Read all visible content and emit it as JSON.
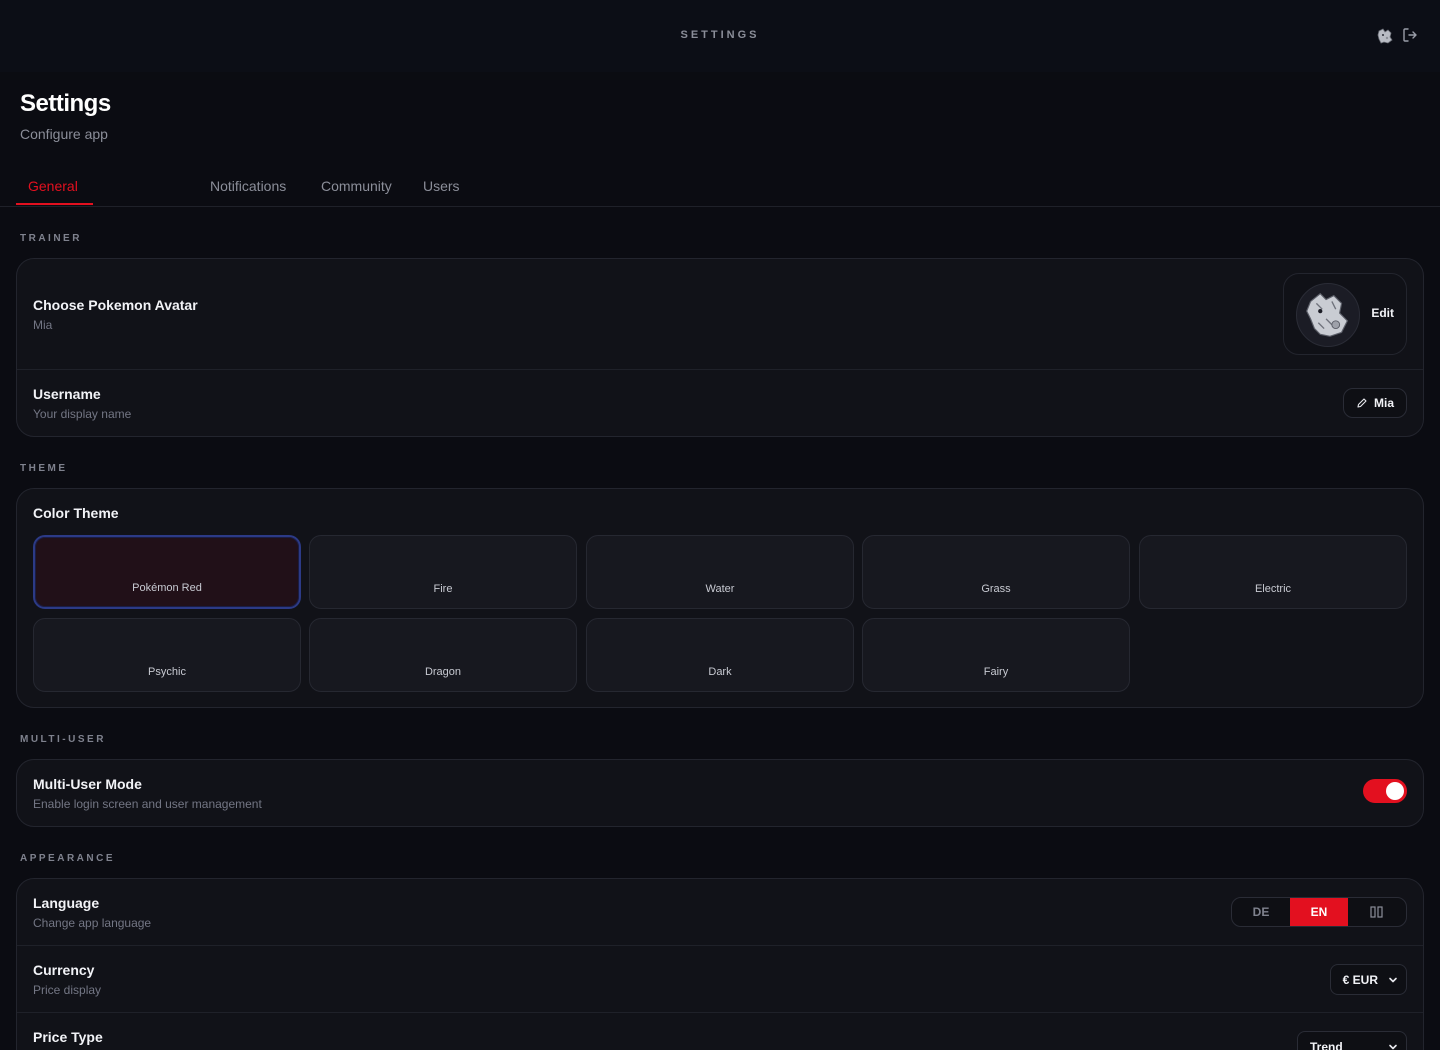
{
  "topbar": {
    "title": "SETTINGS",
    "avatar_icon": "pokemon-avatar-icon",
    "logout_icon": "logout-icon"
  },
  "header": {
    "title": "Settings",
    "subtitle": "Configure app"
  },
  "tabs": [
    {
      "label": "General",
      "active": true
    },
    {
      "label": "Notifications",
      "active": false
    },
    {
      "label": "Community",
      "active": false
    },
    {
      "label": "Users",
      "active": false
    }
  ],
  "sections": {
    "trainer": {
      "label": "TRAINER",
      "avatar": {
        "title": "Choose Pokemon Avatar",
        "subtitle": "Mia",
        "edit_label": "Edit"
      },
      "username": {
        "title": "Username",
        "subtitle": "Your display name",
        "value": "Mia"
      }
    },
    "theme": {
      "label": "THEME",
      "title": "Color Theme",
      "options": [
        "Pokémon Red",
        "Fire",
        "Water",
        "Grass",
        "Electric",
        "Psychic",
        "Dragon",
        "Dark",
        "Fairy"
      ],
      "selected": "Pokémon Red"
    },
    "multiuser": {
      "label": "MULTI-USER",
      "title": "Multi-User Mode",
      "subtitle": "Enable login screen and user management",
      "enabled": true
    },
    "appearance": {
      "label": "APPEARANCE",
      "language": {
        "title": "Language",
        "subtitle": "Change app language",
        "options": [
          "DE",
          "EN"
        ],
        "selected": "EN"
      },
      "currency": {
        "title": "Currency",
        "subtitle": "Price display",
        "value": "€ EUR"
      },
      "price_type": {
        "title": "Price Type",
        "value": "Trend"
      }
    }
  },
  "colors": {
    "accent": "#e3101f",
    "background": "#0b0c12",
    "card": "#111218",
    "selected_border": "#2c3a86"
  }
}
